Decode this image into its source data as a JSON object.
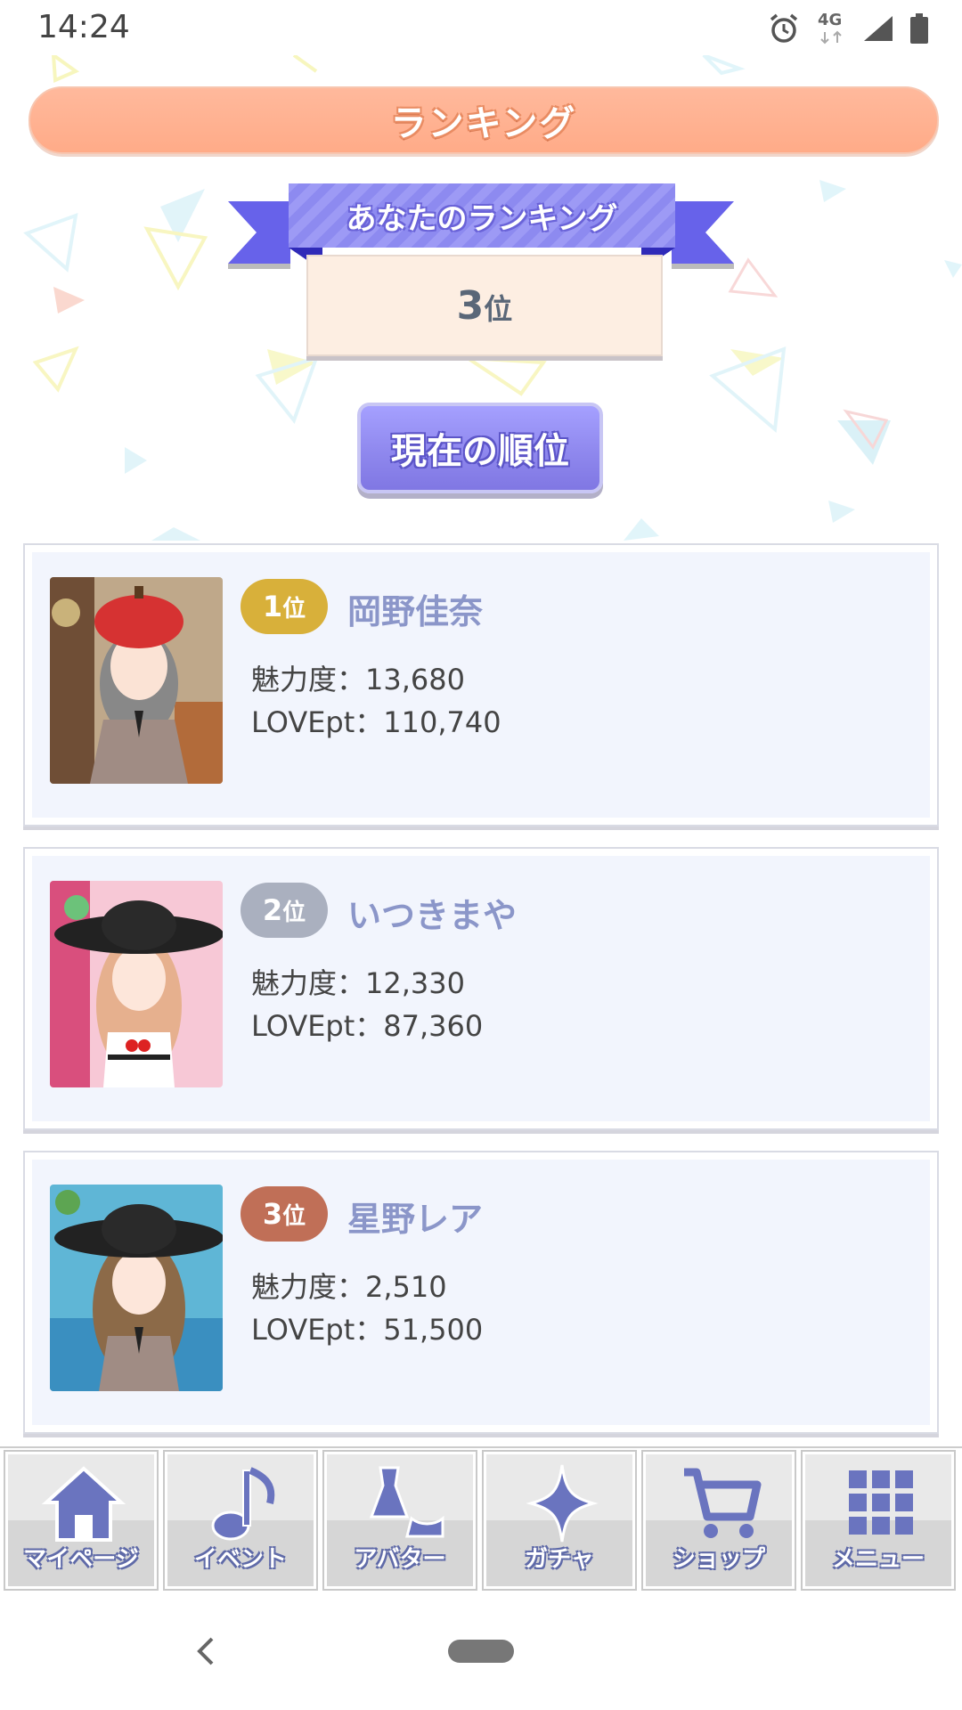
{
  "status_bar": {
    "time": "14:24",
    "network": "4G"
  },
  "header": {
    "title": "ランキング"
  },
  "my_ranking": {
    "label": "あなたのランキング",
    "rank_number": "3",
    "rank_unit": "位"
  },
  "current_rank_button": {
    "label": "現在の順位"
  },
  "rankings": [
    {
      "rank_number": "1",
      "rank_unit": "位",
      "name": "岡野佳奈",
      "charm": "魅力度：13,680",
      "love": "LOVEpt：110,740",
      "badge_color": "#d8b03a"
    },
    {
      "rank_number": "2",
      "rank_unit": "位",
      "name": "いつきまや",
      "charm": "魅力度：12,330",
      "love": "LOVEpt：87,360",
      "badge_color": "#aab0bf"
    },
    {
      "rank_number": "3",
      "rank_unit": "位",
      "name": "星野レア",
      "charm": "魅力度：2,510",
      "love": "LOVEpt：51,500",
      "badge_color": "#c06f57"
    }
  ],
  "bottom_nav": [
    {
      "label": "マイページ",
      "icon": "home-icon"
    },
    {
      "label": "イベント",
      "icon": "music-note-icon"
    },
    {
      "label": "アバター",
      "icon": "dress-icon"
    },
    {
      "label": "ガチャ",
      "icon": "sparkle-icon"
    },
    {
      "label": "ショップ",
      "icon": "cart-icon"
    },
    {
      "label": "メニュー",
      "icon": "grid-menu-icon"
    }
  ],
  "colors": {
    "accent": "#ffab88",
    "purple": "#8f88ee",
    "name": "#8b96c9"
  }
}
